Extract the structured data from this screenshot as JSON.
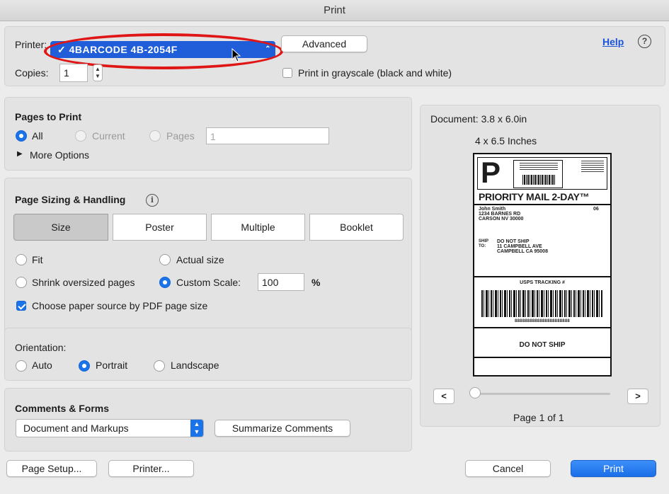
{
  "window": {
    "title": "Print"
  },
  "printer": {
    "label": "Printer:",
    "selected": "4BARCODE 4B-2054F",
    "advanced_label": "Advanced",
    "help_label": "Help",
    "copies_label": "Copies:",
    "copies_value": "1",
    "grayscale_label": "Print in grayscale (black and white)"
  },
  "pages_to_print": {
    "title": "Pages to Print",
    "all_label": "All",
    "current_label": "Current",
    "pages_label": "Pages",
    "pages_value": "1",
    "more_options_label": "More Options"
  },
  "page_sizing": {
    "title": "Page Sizing & Handling",
    "tabs": [
      "Size",
      "Poster",
      "Multiple",
      "Booklet"
    ],
    "fit_label": "Fit",
    "actual_size_label": "Actual size",
    "shrink_label": "Shrink oversized pages",
    "custom_scale_label": "Custom Scale:",
    "custom_scale_value": "100",
    "percent_label": "%",
    "paper_source_label": "Choose paper source by PDF page size"
  },
  "orientation": {
    "title": "Orientation:",
    "auto_label": "Auto",
    "portrait_label": "Portrait",
    "landscape_label": "Landscape"
  },
  "comments_forms": {
    "title": "Comments & Forms",
    "selected": "Document and Markups",
    "summarize_label": "Summarize Comments"
  },
  "preview": {
    "document_size": "Document: 3.8 x 6.0in",
    "paper_size": "4 x 6.5 Inches",
    "page_indicator": "Page 1 of 1",
    "prev_label": "<",
    "next_label": ">",
    "slider_position": 0
  },
  "shipping_label": {
    "p_letter": "P",
    "priority_text": "PRIORITY MAIL 2-DAY™",
    "from_name": "John Smith",
    "from_addr1": "1234 BARNES RD",
    "from_addr2": "CARSON NV 30000",
    "box_num": "06",
    "ship_to_label": "SHIP TO:",
    "to_name": "DO NOT SHIP",
    "to_addr1": "11 CAMPBELL AVE",
    "to_addr2": "CAMPBELL CA 95008",
    "tracking_label": "USPS TRACKING #",
    "tracking_number": "8888888888888888888888",
    "bottom_text": "DO NOT SHIP"
  },
  "footer": {
    "page_setup_label": "Page Setup...",
    "printer_label": "Printer...",
    "cancel_label": "Cancel",
    "print_label": "Print"
  },
  "colors": {
    "accent": "#1a73e8",
    "annotation": "#e01515"
  }
}
